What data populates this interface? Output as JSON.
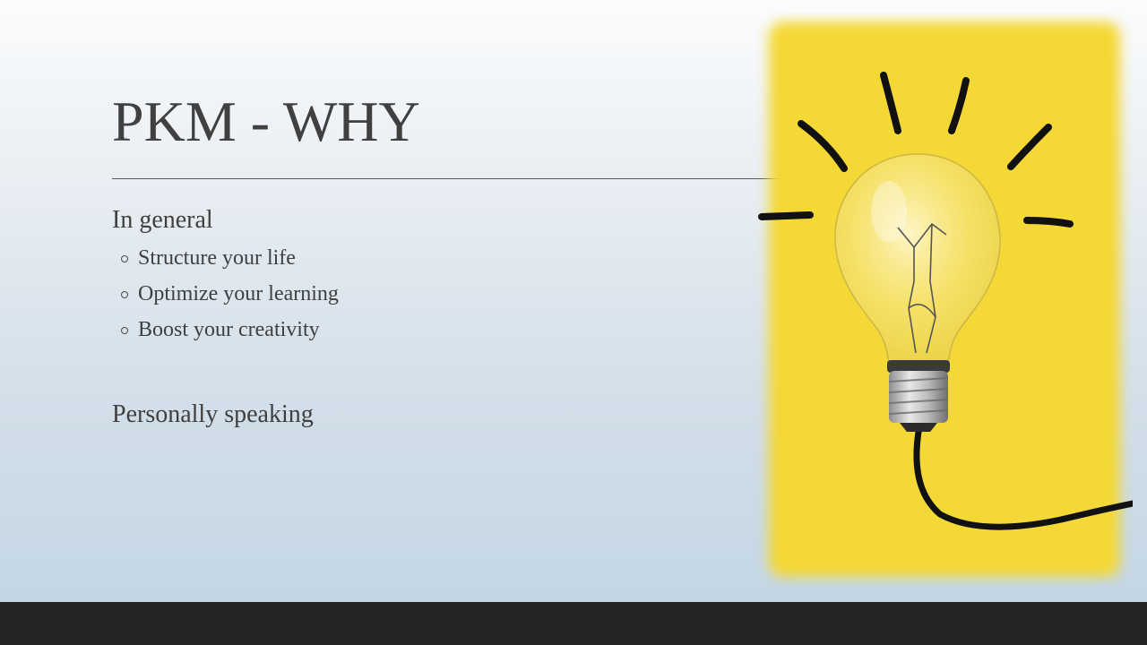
{
  "slide": {
    "title": "PKM - WHY",
    "section_general": {
      "heading": "In general",
      "bullets": [
        "Structure your life",
        "Optimize your learning",
        "Boost your creativity"
      ]
    },
    "section_personal": {
      "heading": "Personally speaking"
    },
    "image": {
      "icon": "lightbulb-icon",
      "background_color": "#f4d835"
    }
  },
  "colors": {
    "text": "#404040",
    "footer": "#242424"
  }
}
